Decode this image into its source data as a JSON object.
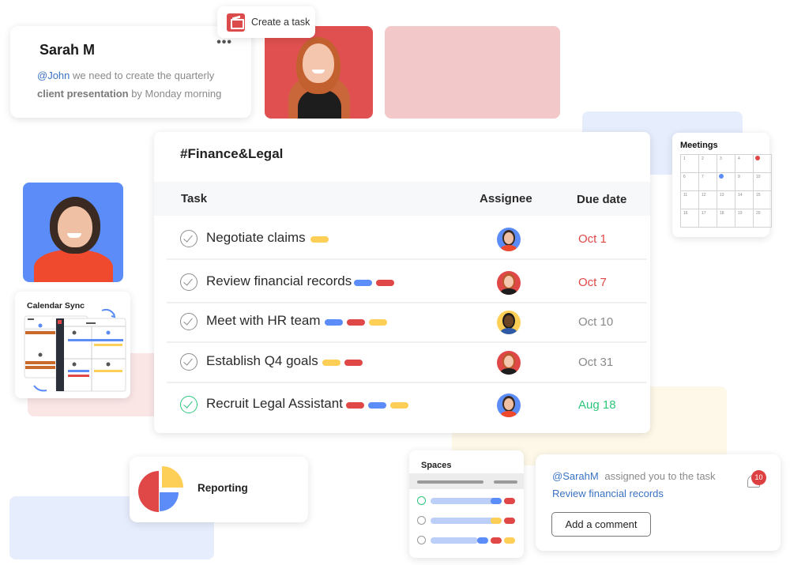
{
  "colors": {
    "red": "#e04848",
    "blue": "#5b8cf7",
    "yellow": "#fecf56",
    "green": "#2cc57b",
    "link": "#3a72c4",
    "muted": "#8a8a8a"
  },
  "message_card": {
    "sender": "Sarah M",
    "more_icon": "more-horizontal-icon",
    "mention": "@John",
    "text_1": " we need to create the quarterly ",
    "bold": "client presentation",
    "text_2": " by Monday morning"
  },
  "create_task": {
    "label": "Create a task",
    "icon": "create-task-icon"
  },
  "task_board": {
    "channel": "#Finance&Legal",
    "columns": [
      "Task",
      "Assignee",
      "Due date"
    ],
    "rows": [
      {
        "task": "Negotiate claims",
        "tags": [
          "yellow"
        ],
        "assignee": "asian-woman",
        "due": "Oct 1",
        "due_color": "#e04848",
        "done": false
      },
      {
        "task": "Review financial records",
        "tags": [
          "blue",
          "red"
        ],
        "assignee": "redhead-woman",
        "due": "Oct 7",
        "due_color": "#e04848",
        "done": false
      },
      {
        "task": "Meet with HR team",
        "tags": [
          "blue",
          "red",
          "yellow"
        ],
        "assignee": "man",
        "due": "Oct 10",
        "due_color": "#8a8a8a",
        "done": false
      },
      {
        "task": "Establish Q4 goals",
        "tags": [
          "yellow",
          "red"
        ],
        "assignee": "redhead-woman",
        "due": "Oct 31",
        "due_color": "#8a8a8a",
        "done": false
      },
      {
        "task": "Recruit Legal Assistant",
        "tags": [
          "red",
          "blue",
          "yellow"
        ],
        "assignee": "asian-woman",
        "due": "Aug 18",
        "due_color": "#2cc57b",
        "done": true
      }
    ]
  },
  "meetings": {
    "title": "Meetings",
    "days": [
      "1",
      "2",
      "3",
      "4",
      "5",
      "6",
      "7",
      "8",
      "9",
      "10",
      "11",
      "12",
      "13",
      "14",
      "15",
      "16",
      "17",
      "18",
      "19",
      "20"
    ],
    "events": [
      {
        "day": "5",
        "color": "red"
      },
      {
        "day": "8",
        "color": "blue"
      }
    ]
  },
  "calendar_sync": {
    "title": "Calendar Sync"
  },
  "reporting": {
    "title": "Reporting",
    "icon": "pie-chart-icon"
  },
  "spaces": {
    "title": "Spaces",
    "rows": [
      {
        "done": true,
        "tags": [
          "blue",
          "red"
        ]
      },
      {
        "done": false,
        "tags": [
          "yellow",
          "red"
        ]
      },
      {
        "done": false,
        "tags": [
          "blue",
          "red",
          "yellow"
        ]
      }
    ]
  },
  "notification": {
    "mention": "@SarahM",
    "text": "assigned you to the task",
    "task_link": "Review financial records",
    "button": "Add a comment",
    "badge_count": "10"
  }
}
